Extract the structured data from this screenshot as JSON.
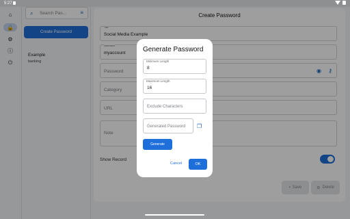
{
  "status_bar": {
    "time": "5:27"
  },
  "rail": {
    "items": [
      "home-icon",
      "lock-icon",
      "gear-icon",
      "info-icon",
      "power-icon"
    ]
  },
  "list": {
    "search_placeholder": "Search Pas...",
    "create_button": "Create Password",
    "items": [
      {
        "title": "Example",
        "subtitle": "banking"
      }
    ]
  },
  "form": {
    "title": "Create Password",
    "fields": [
      {
        "label": "Title",
        "value": "Social Media Example",
        "placeholder": ""
      },
      {
        "label": "Username",
        "value": "myaccount",
        "placeholder": ""
      },
      {
        "label": "",
        "value": "",
        "placeholder": "Password"
      },
      {
        "label": "",
        "value": "",
        "placeholder": "Category"
      },
      {
        "label": "",
        "value": "",
        "placeholder": "URL"
      },
      {
        "label": "",
        "value": "",
        "placeholder": "Note"
      }
    ],
    "show_record_label": "Show Record",
    "show_record_on": true,
    "bottom_buttons": [
      "Save",
      "Delete"
    ]
  },
  "dialog": {
    "title": "Generate Password",
    "min_length_label": "Minimum Length",
    "min_length_value": "8",
    "max_length_label": "Maximum Length",
    "max_length_value": "16",
    "exclude_placeholder": "Exclude Characters",
    "generated_placeholder": "Generated Password",
    "generate_button": "Generate",
    "cancel_button": "Cancel",
    "ok_button": "OK"
  },
  "colors": {
    "accent": "#1e6fd9",
    "scrim": "#000000"
  }
}
